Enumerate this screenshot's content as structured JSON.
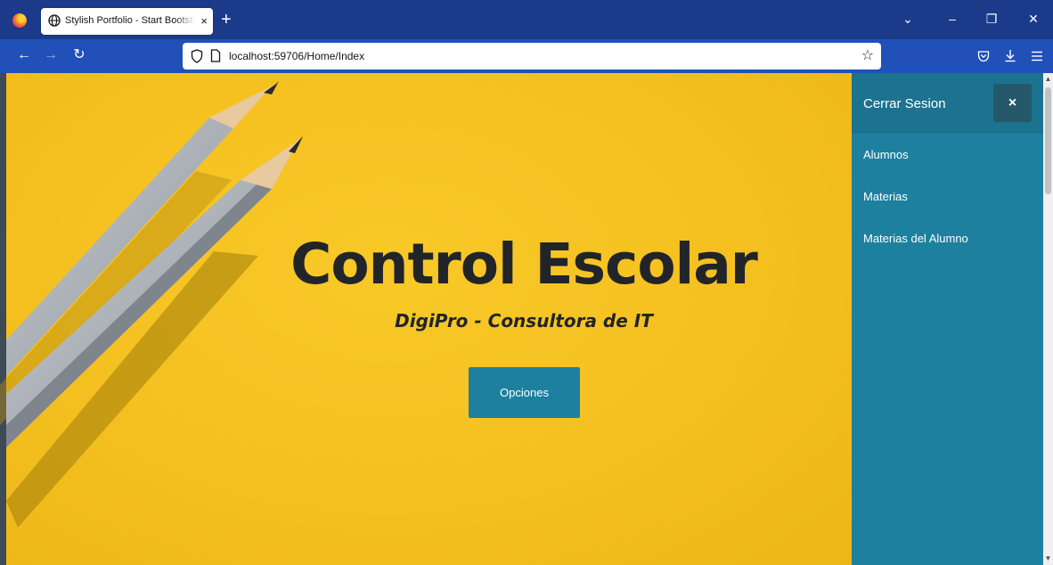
{
  "browser": {
    "tab_title": "Stylish Portfolio - Start Bootstrap Theme",
    "tab_close": "×",
    "new_tab": "+",
    "url": "localhost:59706/Home/Index",
    "window_controls": {
      "list_all_tabs": "⌄",
      "minimize": "–",
      "restore": "❐",
      "close": "✕"
    },
    "icons": [
      "firefox-icon",
      "globe-icon",
      "back-icon",
      "forward-icon",
      "reload-icon",
      "shield-icon",
      "page-icon",
      "bookmark-star-icon",
      "pocket-icon",
      "download-icon",
      "menu-icon"
    ]
  },
  "hero": {
    "title": "Control Escolar",
    "subtitle": "DigiPro - Consultora de IT",
    "button_label": "Opciones"
  },
  "sidebar": {
    "brand": "Cerrar Sesion",
    "close_label": "×",
    "items": [
      {
        "label": "Alumnos"
      },
      {
        "label": "Materias"
      },
      {
        "label": "Materias del Alumno"
      }
    ]
  },
  "colors": {
    "tabbar": "#1b3a8a",
    "navbar": "#2050b8",
    "hero_yellow": "#f4c020",
    "accent_teal": "#1d809f",
    "close_button": "#255868",
    "text_dark": "#212529"
  }
}
